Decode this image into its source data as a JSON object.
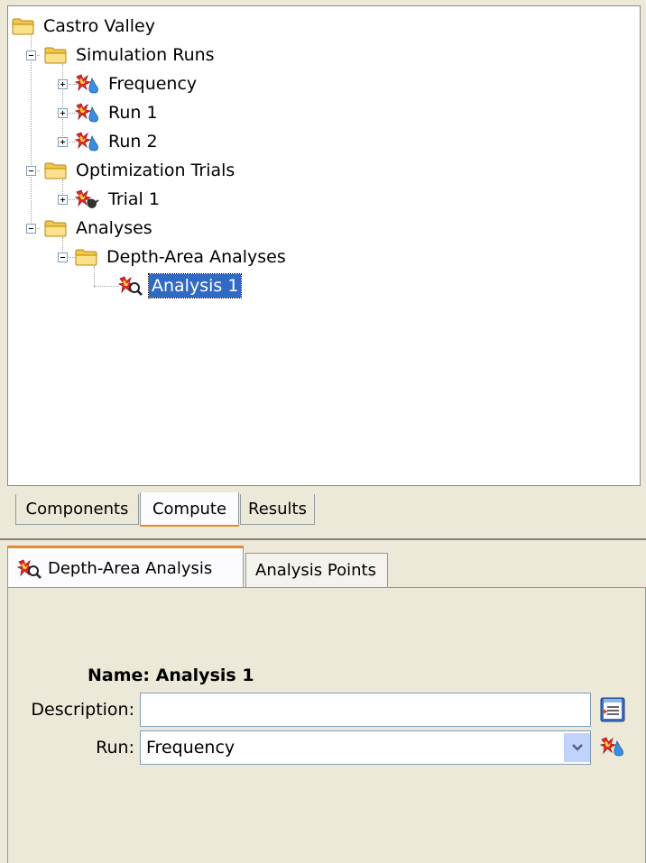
{
  "tree": {
    "root": "Castro Valley",
    "simulation_runs": {
      "label": "Simulation Runs",
      "items": [
        "Frequency",
        "Run 1",
        "Run 2"
      ]
    },
    "optimization_trials": {
      "label": "Optimization Trials",
      "items": [
        "Trial 1"
      ]
    },
    "analyses": {
      "label": "Analyses",
      "depth_area": {
        "label": "Depth-Area Analyses",
        "items": [
          "Analysis 1"
        ]
      }
    },
    "selected": "Analysis 1"
  },
  "tree_tabs": [
    {
      "label": "Components",
      "active": false
    },
    {
      "label": "Compute",
      "active": true
    },
    {
      "label": "Results",
      "active": false
    }
  ],
  "property_tabs": [
    {
      "label": "Depth-Area Analysis",
      "active": true,
      "icon": "analysis-icon"
    },
    {
      "label": "Analysis Points",
      "active": false
    }
  ],
  "form": {
    "name_line": "Name: Analysis 1",
    "description_label": "Description:",
    "description_value": "",
    "run_label": "Run:",
    "run_value": "Frequency"
  },
  "colors": {
    "selection": "#316ac5",
    "tab_accent": "#e68b2c",
    "panel_bg": "#ece9d8"
  }
}
